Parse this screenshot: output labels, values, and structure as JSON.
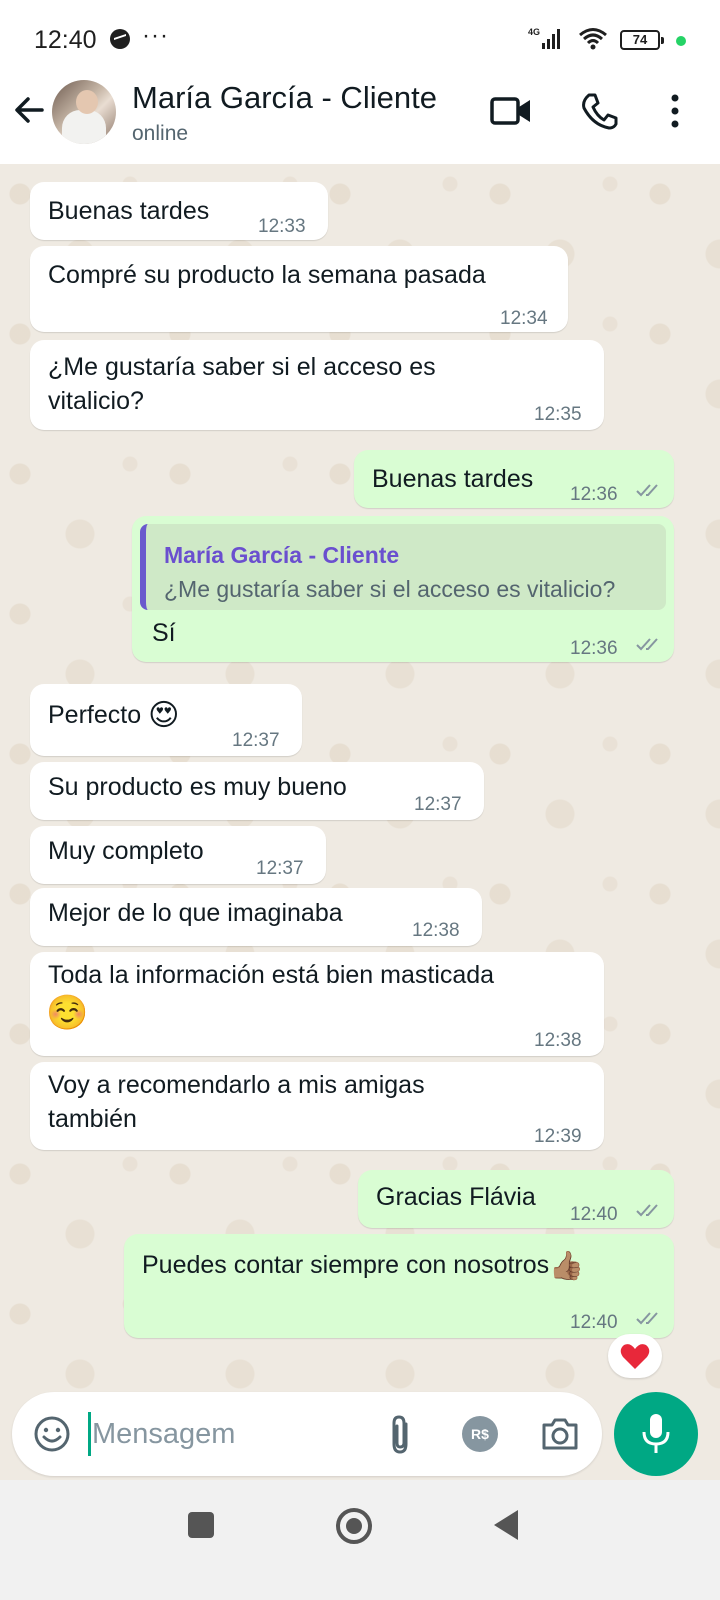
{
  "status_bar": {
    "time": "12:40",
    "more": "···",
    "network": "4G",
    "battery": "74"
  },
  "header": {
    "contact_name": "María García - Cliente",
    "status": "online"
  },
  "messages": [
    {
      "dir": "in",
      "text": "Buenas tardes",
      "time": "12:33"
    },
    {
      "dir": "in",
      "text": "Compré su producto la semana pasada",
      "time": "12:34"
    },
    {
      "dir": "in",
      "text": "¿Me gustaría saber si el acceso es vitalicio?",
      "time": "12:35"
    },
    {
      "dir": "out",
      "text": "Buenas tardes",
      "time": "12:36",
      "read": true
    },
    {
      "dir": "out",
      "text": "Sí",
      "time": "12:36",
      "read": true,
      "reply": {
        "author": "María García - Cliente",
        "text": "¿Me gustaría saber si el acceso es vitalicio?"
      }
    },
    {
      "dir": "in",
      "text": "Perfecto",
      "emoji": "😍",
      "time": "12:37"
    },
    {
      "dir": "in",
      "text": "Su producto es muy bueno",
      "time": "12:37"
    },
    {
      "dir": "in",
      "text": "Muy completo",
      "time": "12:37"
    },
    {
      "dir": "in",
      "text": "Mejor de lo que imaginaba",
      "time": "12:38"
    },
    {
      "dir": "in",
      "text": "Toda la información está bien masticada",
      "emoji": "☺️",
      "time": "12:38"
    },
    {
      "dir": "in",
      "text": "Voy a recomendarlo a mis amigas también",
      "time": "12:39"
    },
    {
      "dir": "out",
      "text": "Gracias Flávia",
      "time": "12:40",
      "read": true
    },
    {
      "dir": "out",
      "text": "Puedes contar siempre con nosotros",
      "emoji": "👍🏽",
      "time": "12:40",
      "read": true,
      "reaction": "heart"
    }
  ],
  "composer": {
    "placeholder": "Mensagem",
    "pay_label": "R$"
  },
  "icons": [
    "back-arrow-icon",
    "video-call-icon",
    "phone-icon",
    "more-vert-icon",
    "emoji-icon",
    "attach-icon",
    "payment-icon",
    "camera-icon",
    "mic-icon",
    "heart-icon"
  ],
  "colors": {
    "outgoing_bubble": "#d9fdd3",
    "incoming_bubble": "#ffffff",
    "accent": "#00a884",
    "ticks": "#8696a0",
    "reply_bar": "#6a5acd"
  }
}
